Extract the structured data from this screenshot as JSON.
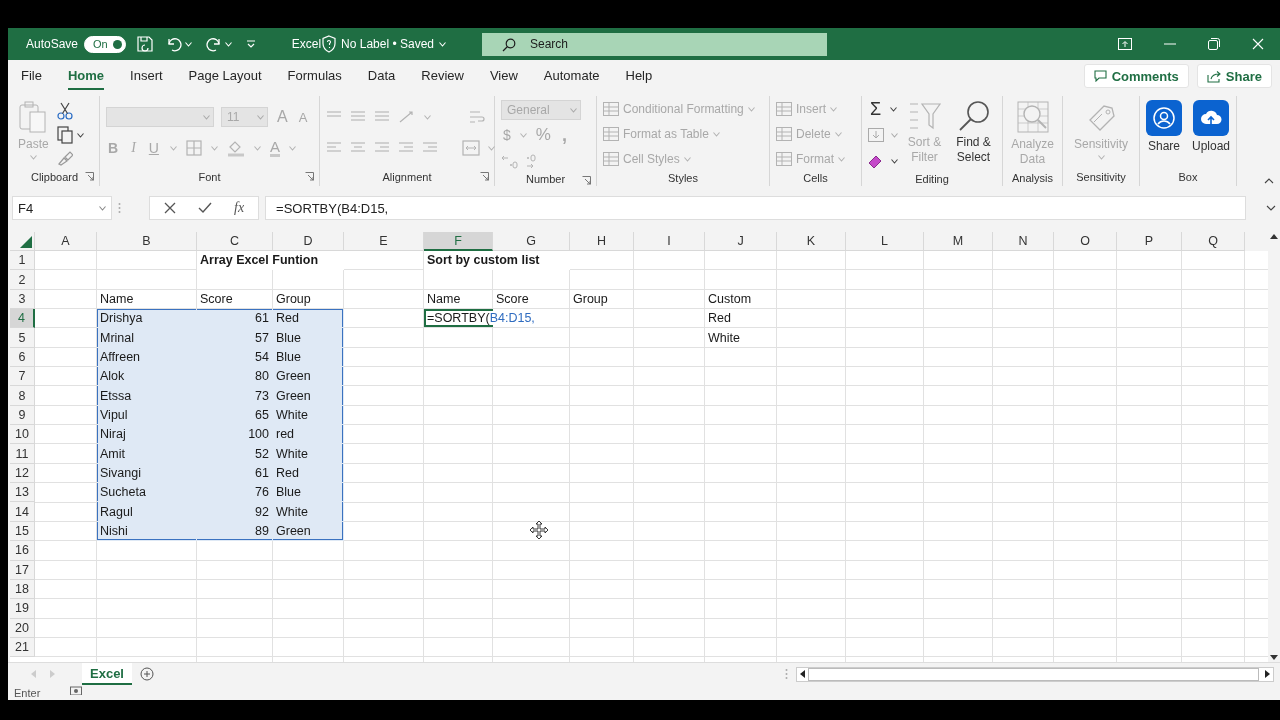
{
  "title_bar": {
    "autosave_label": "AutoSave",
    "autosave_toggle": {
      "label": "On",
      "on": true
    },
    "file_name": "Excel",
    "file_status": "No Label • Saved",
    "search": {
      "placeholder": "Search"
    }
  },
  "menu": {
    "tabs": [
      {
        "label": "File",
        "selected": false
      },
      {
        "label": "Home",
        "selected": true
      },
      {
        "label": "Insert",
        "selected": false
      },
      {
        "label": "Page Layout",
        "selected": false
      },
      {
        "label": "Formulas",
        "selected": false
      },
      {
        "label": "Data",
        "selected": false
      },
      {
        "label": "Review",
        "selected": false
      },
      {
        "label": "View",
        "selected": false
      },
      {
        "label": "Automate",
        "selected": false
      },
      {
        "label": "Help",
        "selected": false
      }
    ],
    "buttons": [
      {
        "label": "Comments",
        "kind": "comments"
      },
      {
        "label": "Share",
        "kind": "share"
      }
    ]
  },
  "ribbon": {
    "groups": [
      {
        "kind": "clipboard",
        "label": "Clipboard",
        "paste": {
          "label": "Paste",
          "disabled": true
        }
      },
      {
        "kind": "font",
        "label": "Font",
        "disabled": true,
        "size": "11",
        "increase_size": "A",
        "decrease_size": "A",
        "bold": "B",
        "italic": "I",
        "underline": "U",
        "font_color": "A"
      },
      {
        "kind": "alignment",
        "label": "Alignment",
        "disabled": true
      },
      {
        "kind": "number",
        "label": "Number",
        "disabled": true,
        "format": "General",
        "currency": "$",
        "percent": "%",
        "comma_style": ","
      },
      {
        "kind": "styles",
        "label": "Styles",
        "commands": [
          {
            "label": "Conditional Formatting",
            "disabled": true
          },
          {
            "label": "Format as Table",
            "disabled": true
          },
          {
            "label": "Cell Styles",
            "disabled": true
          }
        ]
      },
      {
        "kind": "cells",
        "label": "Cells",
        "commands": [
          {
            "label": "Insert",
            "disabled": true
          },
          {
            "label": "Delete",
            "disabled": true
          },
          {
            "label": "Format",
            "disabled": true
          }
        ]
      },
      {
        "kind": "editing",
        "label": "Editing",
        "sum": "Σ",
        "sort_filter": {
          "label": "Sort & Filter",
          "disabled": true
        },
        "find_select": {
          "label": "Find & Select",
          "disabled": false
        }
      },
      {
        "kind": "analysis",
        "label": "Analysis",
        "commands": [
          {
            "label": "Analyze Data",
            "disabled": true
          }
        ]
      },
      {
        "kind": "sensitivity",
        "label": "Sensitivity",
        "commands": [
          {
            "label": "Sensitivity",
            "disabled": true
          }
        ]
      },
      {
        "kind": "box",
        "label": "Box",
        "commands": [
          {
            "label": "Share",
            "disabled": false
          },
          {
            "label": "Upload",
            "disabled": false
          }
        ]
      }
    ]
  },
  "formula_bar": {
    "name_box": "F4",
    "function_label": "fx",
    "formula": "=SORTBY(B4:D15,"
  },
  "sheet": {
    "columns": [
      {
        "label": "A",
        "selected": false
      },
      {
        "label": "B",
        "selected": false
      },
      {
        "label": "C",
        "selected": false
      },
      {
        "label": "D",
        "selected": false
      },
      {
        "label": "E",
        "selected": false
      },
      {
        "label": "F",
        "selected": true
      },
      {
        "label": "G",
        "selected": false
      },
      {
        "label": "H",
        "selected": false
      },
      {
        "label": "I",
        "selected": false
      },
      {
        "label": "J",
        "selected": false
      },
      {
        "label": "K",
        "selected": false
      },
      {
        "label": "L",
        "selected": false
      },
      {
        "label": "M",
        "selected": false
      },
      {
        "label": "N",
        "selected": false
      },
      {
        "label": "O",
        "selected": false
      },
      {
        "label": "P",
        "selected": false
      },
      {
        "label": "Q",
        "selected": false
      }
    ],
    "rows": [
      {
        "label": "1",
        "selected": false,
        "cells": [
          null,
          null,
          {
            "kind": "title",
            "text": "Array Excel Funtion",
            "selected": false
          },
          null,
          null,
          {
            "kind": "title",
            "text": "Sort by custom list",
            "selected": false
          }
        ]
      },
      {
        "label": "2",
        "selected": false,
        "cells": []
      },
      {
        "label": "3",
        "selected": false,
        "cells": [
          null,
          {
            "kind": "text",
            "text": "Name",
            "selected": false
          },
          {
            "kind": "text",
            "text": "Score",
            "selected": false
          },
          {
            "kind": "text",
            "text": "Group",
            "selected": false
          },
          null,
          {
            "kind": "text",
            "text": "Name",
            "selected": false
          },
          {
            "kind": "text",
            "text": "Score",
            "selected": false
          },
          {
            "kind": "text",
            "text": "Group",
            "selected": false
          },
          null,
          {
            "kind": "text",
            "text": "Custom",
            "selected": false
          }
        ]
      },
      {
        "label": "4",
        "selected": true,
        "cells": [
          null,
          {
            "kind": "text",
            "text": "Drishya",
            "selected": true
          },
          {
            "kind": "number",
            "text": "61",
            "selected": true
          },
          {
            "kind": "text",
            "text": "Red",
            "selected": true
          },
          null,
          {
            "kind": "editing",
            "parts": [
              {
                "kind": "plain",
                "text": "=SORTBY("
              },
              {
                "kind": "reference",
                "text": "B4:D15,"
              }
            ],
            "selected": false
          },
          null,
          null,
          null,
          {
            "kind": "text",
            "text": "Red",
            "selected": false
          }
        ]
      },
      {
        "label": "5",
        "selected": false,
        "cells": [
          null,
          {
            "kind": "text",
            "text": "Mrinal",
            "selected": true
          },
          {
            "kind": "number",
            "text": "57",
            "selected": true
          },
          {
            "kind": "text",
            "text": "Blue",
            "selected": true
          },
          null,
          null,
          null,
          null,
          null,
          {
            "kind": "text",
            "text": "White",
            "selected": false
          }
        ]
      },
      {
        "label": "6",
        "selected": false,
        "cells": [
          null,
          {
            "kind": "text",
            "text": "Affreen",
            "selected": true
          },
          {
            "kind": "number",
            "text": "54",
            "selected": true
          },
          {
            "kind": "text",
            "text": "Blue",
            "selected": true
          }
        ]
      },
      {
        "label": "7",
        "selected": false,
        "cells": [
          null,
          {
            "kind": "text",
            "text": "Alok",
            "selected": true
          },
          {
            "kind": "number",
            "text": "80",
            "selected": true
          },
          {
            "kind": "text",
            "text": "Green",
            "selected": true
          }
        ]
      },
      {
        "label": "8",
        "selected": false,
        "cells": [
          null,
          {
            "kind": "text",
            "text": "Etssa",
            "selected": true
          },
          {
            "kind": "number",
            "text": "73",
            "selected": true
          },
          {
            "kind": "text",
            "text": "Green",
            "selected": true
          }
        ]
      },
      {
        "label": "9",
        "selected": false,
        "cells": [
          null,
          {
            "kind": "text",
            "text": "Vipul",
            "selected": true
          },
          {
            "kind": "number",
            "text": "65",
            "selected": true
          },
          {
            "kind": "text",
            "text": "White",
            "selected": true
          }
        ]
      },
      {
        "label": "10",
        "selected": false,
        "cells": [
          null,
          {
            "kind": "text",
            "text": "Niraj",
            "selected": true
          },
          {
            "kind": "number",
            "text": "100",
            "selected": true
          },
          {
            "kind": "text",
            "text": "red",
            "selected": true
          }
        ]
      },
      {
        "label": "11",
        "selected": false,
        "cells": [
          null,
          {
            "kind": "text",
            "text": "Amit",
            "selected": true
          },
          {
            "kind": "number",
            "text": "52",
            "selected": true
          },
          {
            "kind": "text",
            "text": "White",
            "selected": true
          }
        ]
      },
      {
        "label": "12",
        "selected": false,
        "cells": [
          null,
          {
            "kind": "text",
            "text": "Sivangi",
            "selected": true
          },
          {
            "kind": "number",
            "text": "61",
            "selected": true
          },
          {
            "kind": "text",
            "text": "Red",
            "selected": true
          }
        ]
      },
      {
        "label": "13",
        "selected": false,
        "cells": [
          null,
          {
            "kind": "text",
            "text": "Sucheta",
            "selected": true
          },
          {
            "kind": "number",
            "text": "76",
            "selected": true
          },
          {
            "kind": "text",
            "text": "Blue",
            "selected": true
          }
        ]
      },
      {
        "label": "14",
        "selected": false,
        "cells": [
          null,
          {
            "kind": "text",
            "text": "Ragul",
            "selected": true
          },
          {
            "kind": "number",
            "text": "92",
            "selected": true
          },
          {
            "kind": "text",
            "text": "White",
            "selected": true
          }
        ]
      },
      {
        "label": "15",
        "selected": false,
        "cells": [
          null,
          {
            "kind": "text",
            "text": "Nishi",
            "selected": true
          },
          {
            "kind": "number",
            "text": "89",
            "selected": true
          },
          {
            "kind": "text",
            "text": "Green",
            "selected": true
          }
        ]
      },
      {
        "label": "16",
        "selected": false,
        "cells": []
      },
      {
        "label": "17",
        "selected": false,
        "cells": []
      },
      {
        "label": "18",
        "selected": false,
        "cells": []
      },
      {
        "label": "19",
        "selected": false,
        "cells": []
      },
      {
        "label": "20",
        "selected": false,
        "cells": []
      },
      {
        "label": "21",
        "selected": false,
        "cells": []
      }
    ]
  },
  "sheet_tabs": [
    {
      "label": "Excel",
      "selected": true
    }
  ],
  "status_bar": {
    "mode": "Enter"
  }
}
